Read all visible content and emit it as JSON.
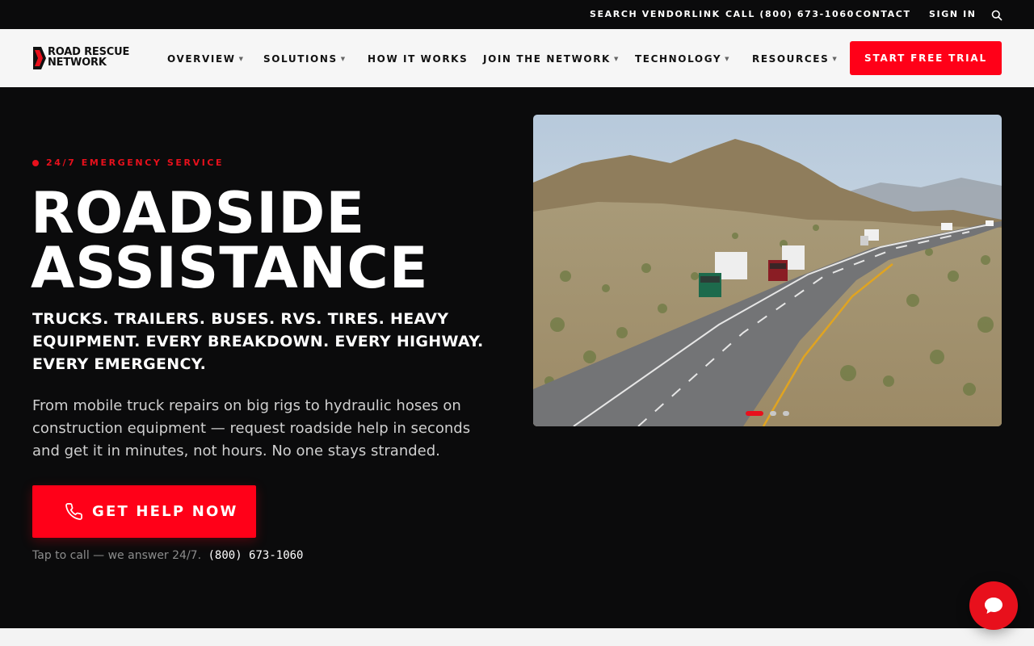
{
  "utility_nav": {
    "search_vendorlink": "SEARCH VENDORLINK",
    "call": "CALL (800) 673-1060",
    "contact": "CONTACT",
    "sign_in": "SIGN IN",
    "search_icon": "search-icon"
  },
  "brand": {
    "line1": "ROAD RESCUE",
    "line2": "NETWORK",
    "accent": "#e8101c"
  },
  "main_nav": {
    "items": [
      {
        "label": "OVERVIEW",
        "has_dropdown": true
      },
      {
        "label": "SOLUTIONS",
        "has_dropdown": true
      },
      {
        "label": "HOW IT WORKS",
        "has_dropdown": false
      },
      {
        "label": "JOIN THE NETWORK",
        "has_dropdown": true
      },
      {
        "label": "TECHNOLOGY",
        "has_dropdown": true
      },
      {
        "label": "RESOURCES",
        "has_dropdown": true
      }
    ],
    "caret": "▼",
    "cta": "START FREE TRIAL"
  },
  "hero": {
    "eyebrow": "24/7 EMERGENCY SERVICE",
    "headline_line1": "ROADSIDE",
    "headline_line2": "ASSISTANCE",
    "subhead": "TRUCKS. TRAILERS. BUSES. RVS. TIRES. HEAVY EQUIPMENT. EVERY BREAKDOWN. EVERY HIGHWAY. EVERY EMERGENCY.",
    "body": "From mobile truck repairs on big rigs to hydraulic hoses on construction equipment — request roadside help in seconds and get it in minutes, not hours. No one stays stranded.",
    "cta_label": "GET HELP NOW",
    "cta_icon": "phone-icon",
    "tap_text": "Tap to call — we answer 24/7.",
    "phone": "(800) 673-1060"
  },
  "carousel": {
    "slide_count": 3,
    "active_index": 0,
    "image_subject": "semi trucks on desert highway"
  },
  "chat": {
    "icon": "chat-bubble-icon"
  },
  "colors": {
    "brand_red": "#ff0018",
    "background": "#0b0b0c",
    "nav_background": "#f6f6f6"
  }
}
